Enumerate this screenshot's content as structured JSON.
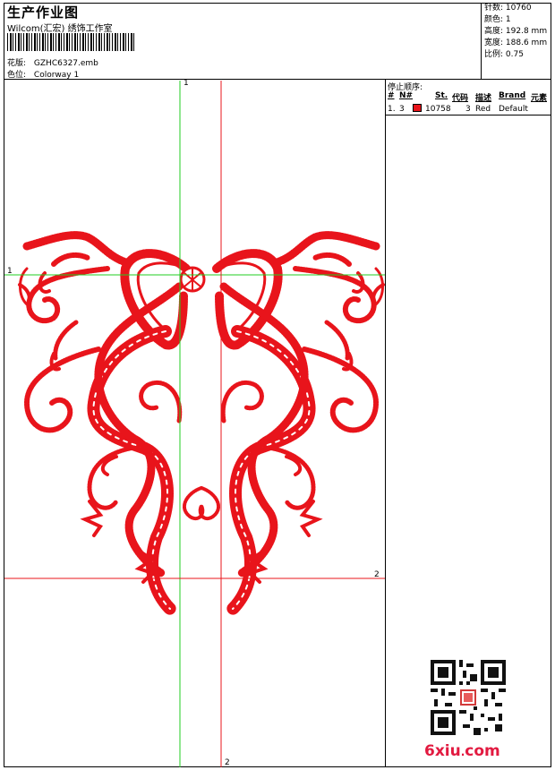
{
  "header": {
    "title": "生产作业图",
    "subtitle": "Wilcom(汇宏) 绣饰工作室",
    "design_label": "花版:",
    "design_value": "GZHC6327.emb",
    "colorway_label": "色位:",
    "colorway_value": "Colorway 1"
  },
  "stats": [
    {
      "label": "针数:",
      "value": "10760"
    },
    {
      "label": "颜色:",
      "value": "1"
    },
    {
      "label": "高度:",
      "value": "192.8 mm"
    },
    {
      "label": "宽度:",
      "value": "188.6 mm"
    },
    {
      "label": "比例:",
      "value": "0.75"
    }
  ],
  "stop_sequence": {
    "title": "停止顺序:",
    "headers": [
      "#",
      "N#",
      "St.",
      "代码",
      "描述",
      "Brand",
      "元素"
    ],
    "rows": [
      {
        "index": "1.",
        "n": "3",
        "code": "10758",
        "st": "3",
        "desc": "Red",
        "brand": "Default",
        "color": "#e8141b"
      }
    ]
  },
  "guides": {
    "v1": "1",
    "h1": "1",
    "h2": "2",
    "v2": "2"
  },
  "watermark": {
    "brand_main": "6xiu",
    "brand_dot": ".",
    "brand_tld": "com"
  },
  "colors": {
    "thread": "#e8141b",
    "guide_green": "#22cc22",
    "guide_red": "#e8141b"
  }
}
